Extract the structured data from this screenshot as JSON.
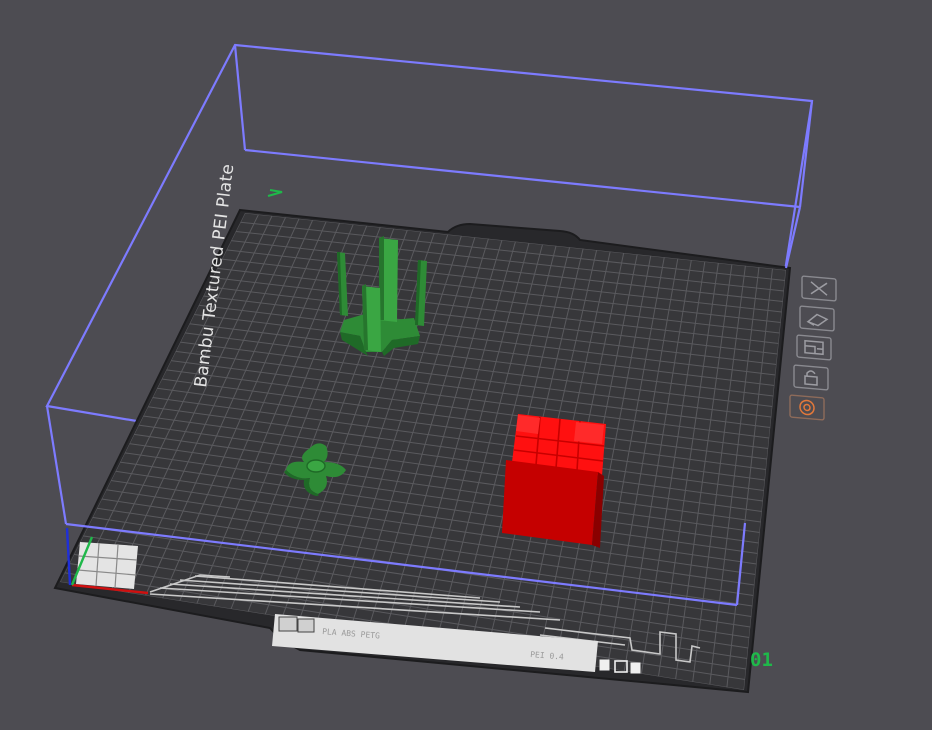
{
  "scene": {
    "background": "#4d4c52",
    "plate": {
      "label": "Bambu Textured PEI Plate",
      "number": "01",
      "strip_text_left": "PLA ABS PETG",
      "strip_text_right": "PEI 0.4"
    },
    "colors": {
      "bounding_box": "#7d7bff",
      "plate_surface": "#37373a",
      "grid_line": "#5a5a5e",
      "model_green": "#2e8b36",
      "model_red": "#e00000",
      "axis_x": "#d01010",
      "axis_y": "#1fb84a",
      "axis_z": "#1f2fd8"
    },
    "objects": [
      {
        "name": "antenna-tower",
        "color": "green"
      },
      {
        "name": "propeller-hub",
        "color": "green"
      },
      {
        "name": "segmented-cube",
        "color": "red"
      }
    ]
  },
  "toolbar": {
    "buttons": [
      {
        "id": "close",
        "icon": "close-x-icon"
      },
      {
        "id": "auto-orient",
        "icon": "orient-icon"
      },
      {
        "id": "arrange",
        "icon": "arrange-icon"
      },
      {
        "id": "lock",
        "icon": "lock-icon"
      },
      {
        "id": "plate-settings",
        "icon": "settings-target-icon"
      }
    ]
  }
}
